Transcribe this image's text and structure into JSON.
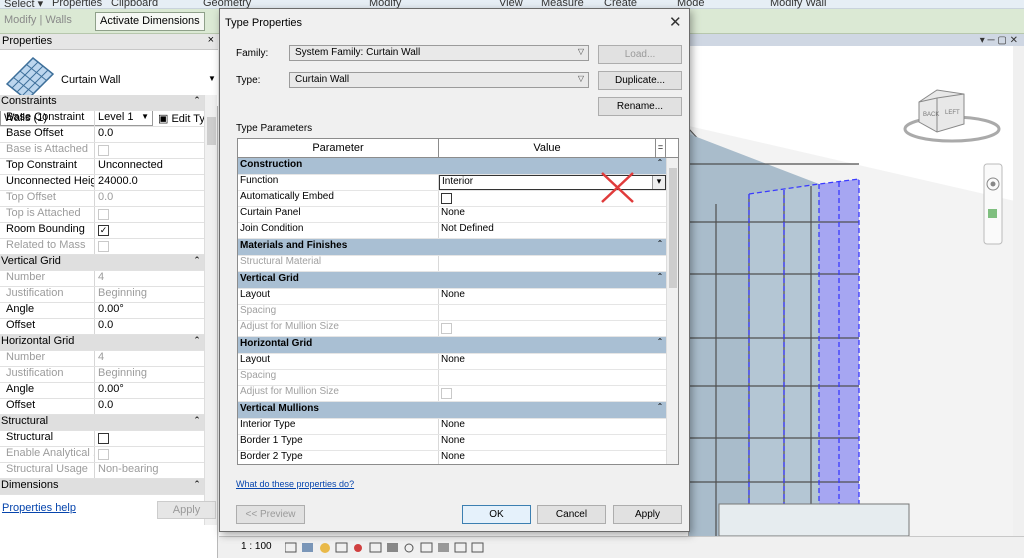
{
  "ribbon": {
    "tabs": [
      "Select ▾",
      "Properties",
      "Clipboard",
      "Geometry",
      "Modify",
      "View",
      "Measure",
      "Create",
      "Mode",
      "Modify Wall"
    ],
    "context_label": "Modify | Walls",
    "activate_dimensions": "Activate Dimensions"
  },
  "properties": {
    "title": "Properties",
    "close": "×",
    "type_name": "Curtain Wall",
    "instance_selector": "Walls (1)",
    "edit_type": "Edit Type",
    "rows": [
      {
        "kind": "section",
        "label": "Constraints"
      },
      {
        "label": "Base Constraint",
        "value": "Level 1"
      },
      {
        "label": "Base Offset",
        "value": "0.0"
      },
      {
        "label": "Base is Attached",
        "value": "",
        "check": "dim",
        "disabled": true
      },
      {
        "label": "Top Constraint",
        "value": "Unconnected"
      },
      {
        "label": "Unconnected Heig...",
        "value": "24000.0"
      },
      {
        "label": "Top Offset",
        "value": "0.0",
        "disabled": true
      },
      {
        "label": "Top is Attached",
        "value": "",
        "check": "dim",
        "disabled": true
      },
      {
        "label": "Room Bounding",
        "value": "✓",
        "check": "on"
      },
      {
        "label": "Related to Mass",
        "value": "",
        "check": "dim",
        "disabled": true
      },
      {
        "kind": "section",
        "label": "Vertical Grid"
      },
      {
        "label": "Number",
        "value": "4",
        "disabled": true
      },
      {
        "label": "Justification",
        "value": "Beginning",
        "disabled": true
      },
      {
        "label": "Angle",
        "value": "0.00°"
      },
      {
        "label": "Offset",
        "value": "0.0"
      },
      {
        "kind": "section",
        "label": "Horizontal Grid"
      },
      {
        "label": "Number",
        "value": "4",
        "disabled": true
      },
      {
        "label": "Justification",
        "value": "Beginning",
        "disabled": true
      },
      {
        "label": "Angle",
        "value": "0.00°"
      },
      {
        "label": "Offset",
        "value": "0.0"
      },
      {
        "kind": "section",
        "label": "Structural"
      },
      {
        "label": "Structural",
        "value": "",
        "check": "off"
      },
      {
        "label": "Enable Analytical ...",
        "value": "",
        "check": "dim",
        "disabled": true
      },
      {
        "label": "Structural Usage",
        "value": "Non-bearing",
        "disabled": true
      },
      {
        "kind": "section",
        "label": "Dimensions"
      }
    ],
    "help_link": "Properties help",
    "apply": "Apply"
  },
  "statusbar": {
    "scale": "1 : 100"
  },
  "dialog": {
    "title": "Type Properties",
    "family_label": "Family:",
    "family_value": "System Family: Curtain Wall",
    "type_label": "Type:",
    "type_value": "Curtain Wall",
    "load": "Load...",
    "duplicate": "Duplicate...",
    "rename": "Rename...",
    "type_params_label": "Type Parameters",
    "col_parameter": "Parameter",
    "col_value": "Value",
    "col_eq": "=",
    "rows": [
      {
        "kind": "section",
        "label": "Construction"
      },
      {
        "label": "Function",
        "value": "Interior",
        "selected": true
      },
      {
        "label": "Automatically Embed",
        "value": "",
        "check": "off"
      },
      {
        "label": "Curtain Panel",
        "value": "None"
      },
      {
        "label": "Join Condition",
        "value": "Not Defined"
      },
      {
        "kind": "section",
        "label": "Materials and Finishes"
      },
      {
        "label": "Structural Material",
        "value": "",
        "disabled": true
      },
      {
        "kind": "section",
        "label": "Vertical Grid"
      },
      {
        "label": "Layout",
        "value": "None"
      },
      {
        "label": "Spacing",
        "value": "",
        "disabled": true
      },
      {
        "label": "Adjust for Mullion Size",
        "value": "",
        "check": "dim",
        "disabled": true
      },
      {
        "kind": "section",
        "label": "Horizontal Grid"
      },
      {
        "label": "Layout",
        "value": "None"
      },
      {
        "label": "Spacing",
        "value": "",
        "disabled": true
      },
      {
        "label": "Adjust for Mullion Size",
        "value": "",
        "check": "dim",
        "disabled": true
      },
      {
        "kind": "section",
        "label": "Vertical Mullions"
      },
      {
        "label": "Interior Type",
        "value": "None"
      },
      {
        "label": "Border 1 Type",
        "value": "None"
      },
      {
        "label": "Border 2 Type",
        "value": "None"
      }
    ],
    "help_link": "What do these properties do?",
    "preview": "<< Preview",
    "ok": "OK",
    "cancel": "Cancel",
    "apply": "Apply"
  },
  "viewcube": {
    "face_back": "BACK",
    "face_left": "LEFT"
  },
  "colors": {
    "selection": "#3b3bff",
    "glass": "#9fb6c6",
    "section_header": "#a9bfd3",
    "context_tab": "#dbe9d4"
  }
}
